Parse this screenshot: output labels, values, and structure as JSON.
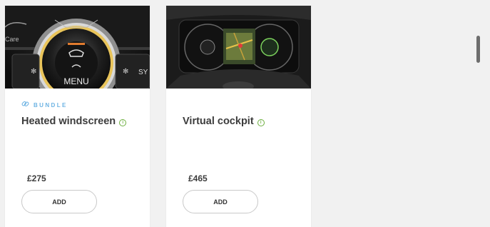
{
  "cards": [
    {
      "badge": "BUNDLE",
      "title": "Heated windscreen",
      "price": "£275",
      "button": "ADD",
      "image_text": {
        "menu": "MENU",
        "care": "Care",
        "sy": "SY"
      }
    },
    {
      "title": "Virtual cockpit",
      "price": "£465",
      "button": "ADD"
    }
  ],
  "colors": {
    "badge": "#6db3e3",
    "info": "#6cae3e",
    "text": "#3c3c3c"
  },
  "icons": {
    "badge": "link-chain-icon",
    "info": "info-icon"
  }
}
